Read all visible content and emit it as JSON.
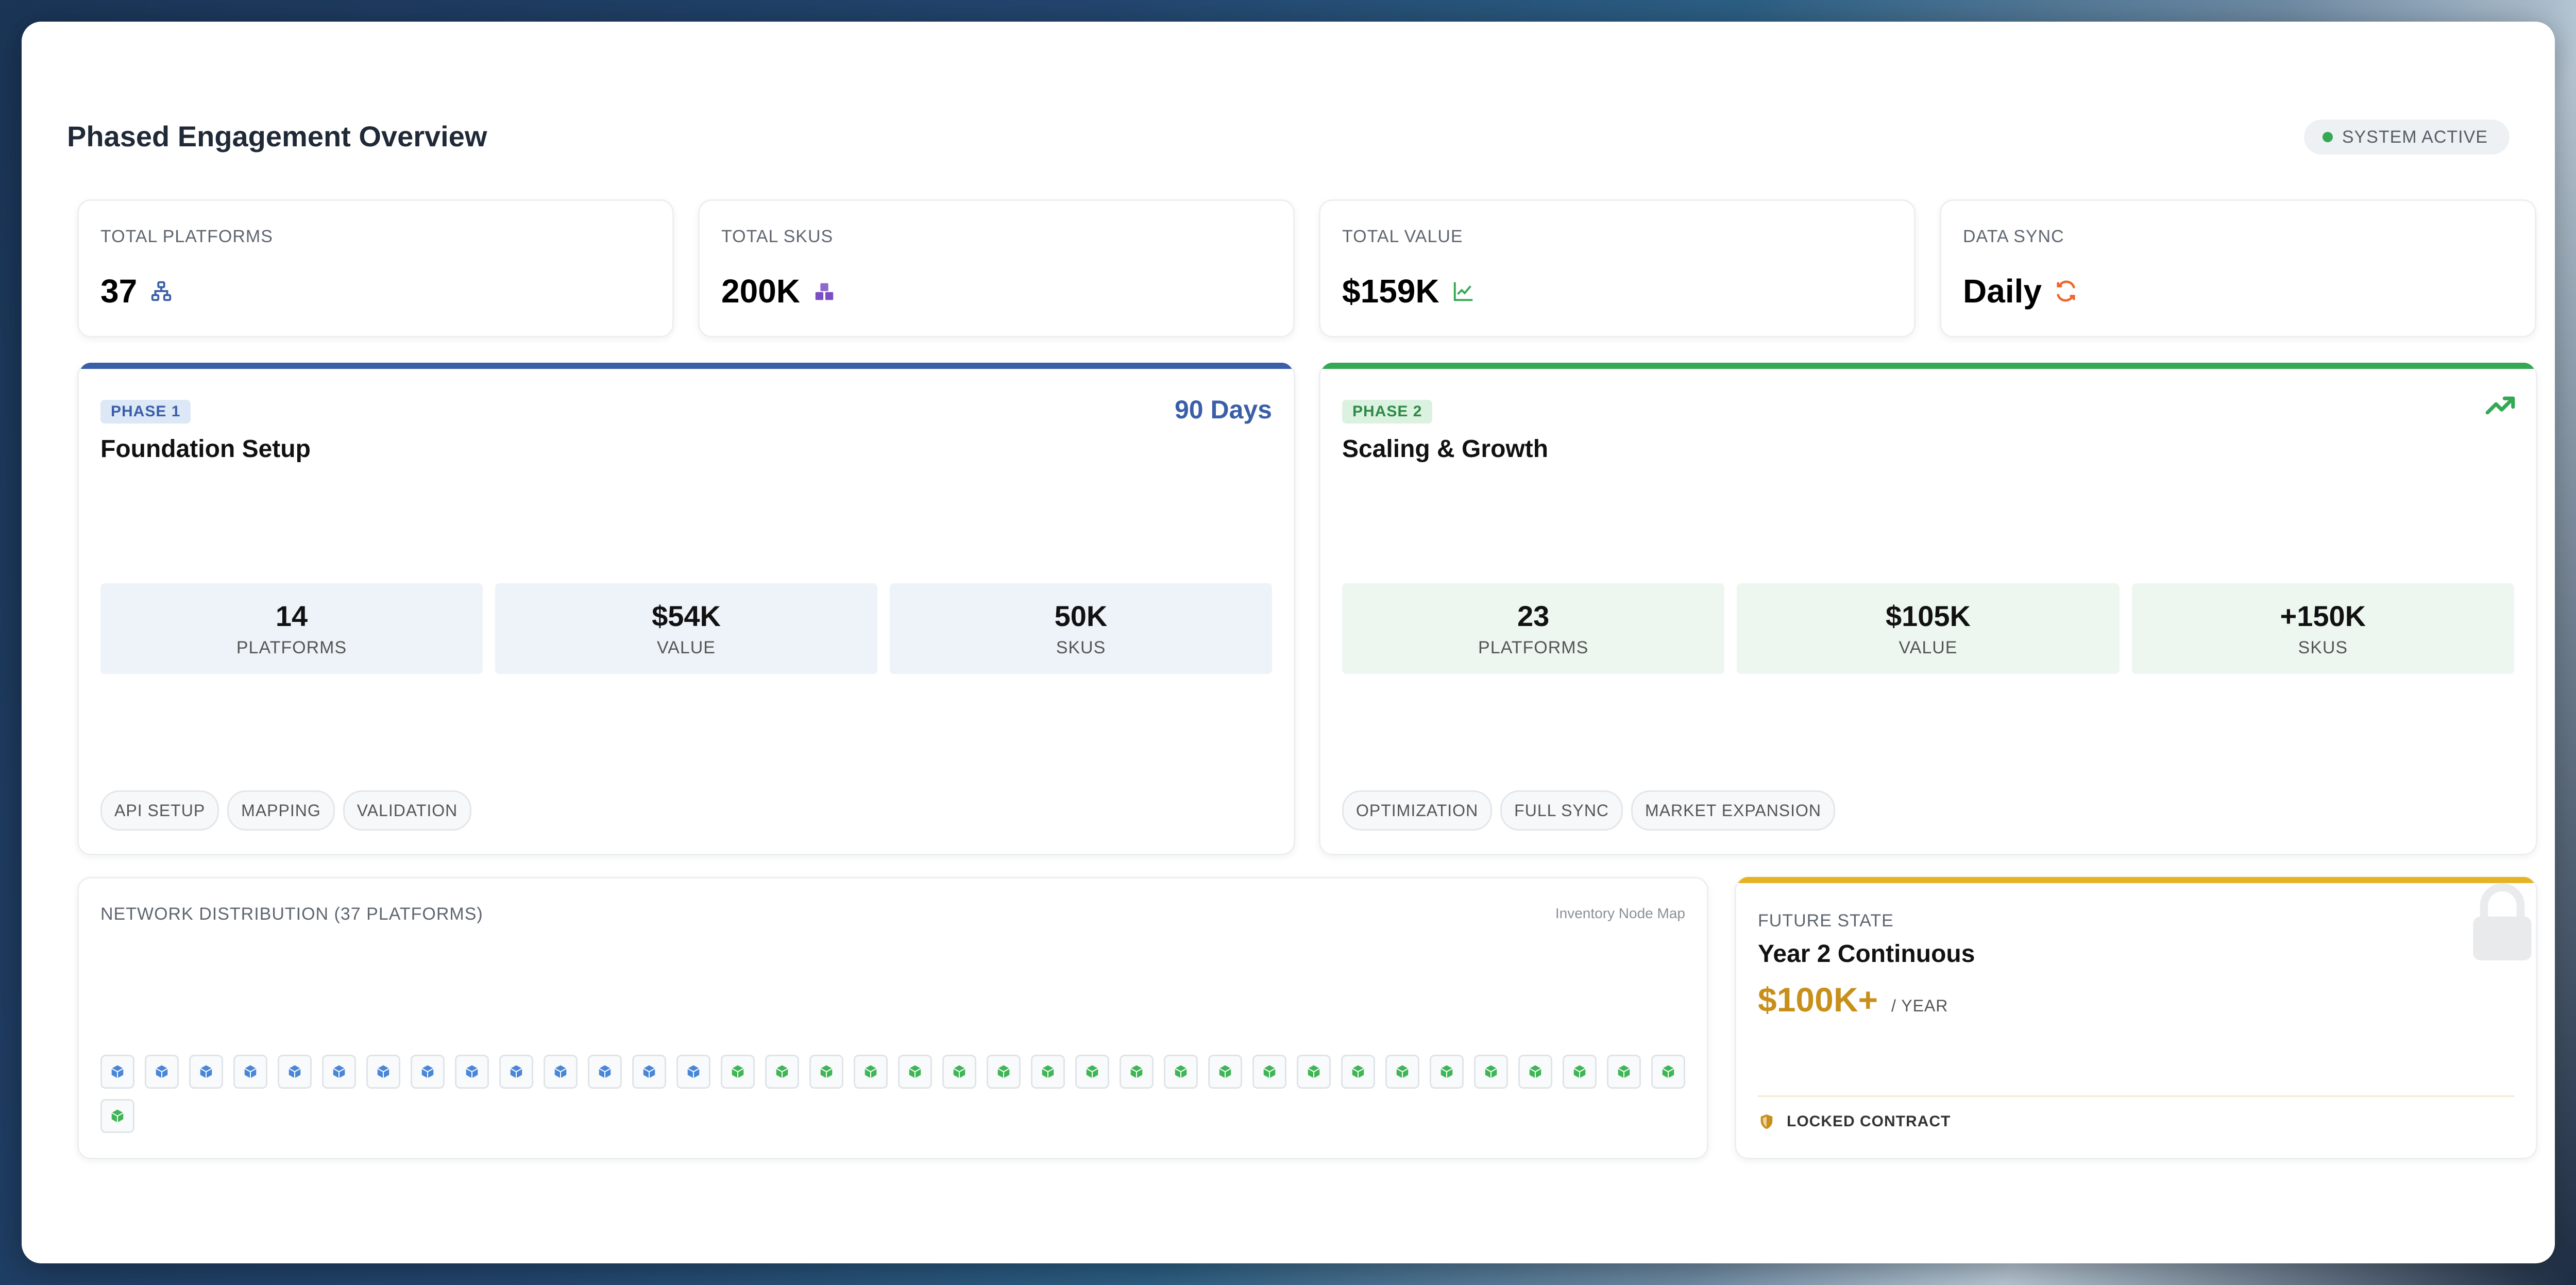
{
  "header": {
    "title": "Phased Engagement Overview",
    "status": "SYSTEM ACTIVE"
  },
  "stats": [
    {
      "label": "TOTAL PLATFORMS",
      "value": "37",
      "icon": "network-icon",
      "icon_color": "#3a5ea7"
    },
    {
      "label": "TOTAL SKUS",
      "value": "200K",
      "icon": "boxes-icon",
      "icon_color": "#7b4fc4"
    },
    {
      "label": "TOTAL VALUE",
      "value": "$159K",
      "icon": "line-chart-icon",
      "icon_color": "#34a853"
    },
    {
      "label": "DATA SYNC",
      "value": "Daily",
      "icon": "sync-icon",
      "icon_color": "#f0662a"
    }
  ],
  "phase1": {
    "badge": "PHASE 1",
    "title": "Foundation Setup",
    "duration": "90 Days",
    "accent": "#3a5ea7",
    "metrics": [
      {
        "value": "14",
        "label": "PLATFORMS"
      },
      {
        "value": "$54K",
        "label": "VALUE"
      },
      {
        "value": "50K",
        "label": "SKUS"
      }
    ],
    "tags": [
      "API SETUP",
      "MAPPING",
      "VALIDATION"
    ]
  },
  "phase2": {
    "badge": "PHASE 2",
    "title": "Scaling & Growth",
    "accent": "#34a853",
    "icon": "trending-up-icon",
    "metrics": [
      {
        "value": "23",
        "label": "PLATFORMS"
      },
      {
        "value": "$105K",
        "label": "VALUE"
      },
      {
        "value": "+150K",
        "label": "SKUS"
      }
    ],
    "tags": [
      "OPTIMIZATION",
      "FULL SYNC",
      "MARKET EXPANSION"
    ]
  },
  "network": {
    "title": "NETWORK DISTRIBUTION (37 PLATFORMS)",
    "subtitle": "Inventory Node Map",
    "phase1_nodes": 14,
    "phase2_nodes": 23,
    "phase1_color": "#4a86d6",
    "phase2_color": "#3fb556"
  },
  "future": {
    "label": "FUTURE STATE",
    "title": "Year 2 Continuous",
    "amount": "$100K+",
    "unit": "/ YEAR",
    "lock_text": "LOCKED CONTRACT",
    "accent": "#e6b325"
  }
}
